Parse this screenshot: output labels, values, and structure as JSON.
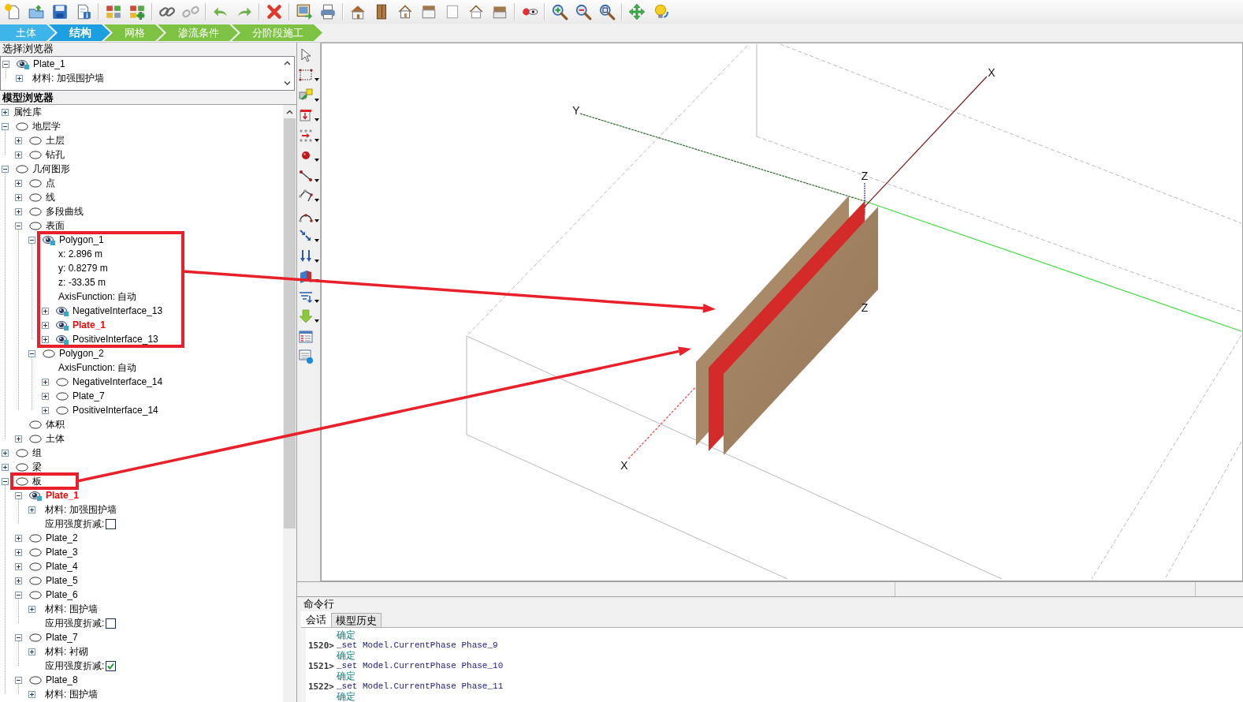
{
  "phases": [
    {
      "label": "土体",
      "color": "#3db5ea",
      "selected": false
    },
    {
      "label": "结构",
      "color": "#1c9fe0",
      "selected": true
    },
    {
      "label": "网格",
      "color": "#7dc242",
      "selected": false
    },
    {
      "label": "渗流条件",
      "color": "#7dc242",
      "selected": false
    },
    {
      "label": "分阶段施工",
      "color": "#7dc242",
      "selected": false
    }
  ],
  "selection_browser": {
    "title": "选择浏览器",
    "items": [
      {
        "kind": "object",
        "label": "Plate_1",
        "expanded": true,
        "visible": true,
        "selected": false,
        "highlighted": false,
        "children": [
          {
            "kind": "property",
            "label": "材料: 加强围护墙",
            "expanded": false,
            "selected": false,
            "highlighted": false
          }
        ]
      }
    ]
  },
  "model_browser": {
    "title": "模型浏览器",
    "tree": [
      {
        "kind": "group",
        "label": "属性库",
        "expanded": false,
        "selected": false,
        "highlighted": false
      },
      {
        "kind": "object",
        "label": "地层学",
        "expanded": true,
        "visible": false,
        "selected": false,
        "highlighted": false,
        "children": [
          {
            "kind": "object",
            "label": "土层",
            "expanded": false,
            "visible": false,
            "selected": false,
            "highlighted": false
          },
          {
            "kind": "object",
            "label": "钻孔",
            "expanded": false,
            "visible": false,
            "selected": false,
            "highlighted": false
          }
        ]
      },
      {
        "kind": "object",
        "label": "几何图形",
        "expanded": true,
        "visible": false,
        "selected": false,
        "highlighted": false,
        "children": [
          {
            "kind": "object",
            "label": "点",
            "expanded": false,
            "visible": false,
            "selected": false,
            "highlighted": false
          },
          {
            "kind": "object",
            "label": "线",
            "expanded": false,
            "visible": false,
            "selected": false,
            "highlighted": false
          },
          {
            "kind": "object",
            "label": "多段曲线",
            "expanded": false,
            "visible": false,
            "selected": false,
            "highlighted": false
          },
          {
            "kind": "object",
            "label": "表面",
            "expanded": true,
            "visible": false,
            "selected": false,
            "highlighted": false,
            "children": [
              {
                "kind": "object",
                "label": "Polygon_1",
                "expanded": true,
                "visible": true,
                "selected": false,
                "highlighted": true,
                "children": [
                  {
                    "kind": "property",
                    "label": "x: 2.896 m",
                    "selected": false,
                    "highlighted": true
                  },
                  {
                    "kind": "property",
                    "label": "y: 0.8279 m",
                    "selected": false,
                    "highlighted": true
                  },
                  {
                    "kind": "property",
                    "label": "z: -33.35 m",
                    "selected": false,
                    "highlighted": true
                  },
                  {
                    "kind": "property",
                    "label": "AxisFunction: 自动",
                    "selected": false,
                    "highlighted": true
                  },
                  {
                    "kind": "object",
                    "label": "NegativeInterface_13",
                    "expanded": false,
                    "visible": true,
                    "selected": false,
                    "highlighted": true
                  },
                  {
                    "kind": "object",
                    "label": "Plate_1",
                    "expanded": false,
                    "visible": true,
                    "selected": true,
                    "highlighted": true
                  },
                  {
                    "kind": "object",
                    "label": "PositiveInterface_13",
                    "expanded": false,
                    "visible": true,
                    "selected": false,
                    "highlighted": true
                  }
                ]
              },
              {
                "kind": "object",
                "label": "Polygon_2",
                "expanded": true,
                "visible": false,
                "selected": false,
                "highlighted": false,
                "children": [
                  {
                    "kind": "property",
                    "label": "AxisFunction: 自动",
                    "selected": false,
                    "highlighted": false
                  },
                  {
                    "kind": "object",
                    "label": "NegativeInterface_14",
                    "expanded": false,
                    "visible": false,
                    "selected": false,
                    "highlighted": false
                  },
                  {
                    "kind": "object",
                    "label": "Plate_7",
                    "expanded": false,
                    "visible": false,
                    "selected": false,
                    "highlighted": false
                  },
                  {
                    "kind": "object",
                    "label": "PositiveInterface_14",
                    "expanded": false,
                    "visible": false,
                    "selected": false,
                    "highlighted": false
                  }
                ]
              }
            ]
          },
          {
            "kind": "object",
            "label": "体积",
            "visible": false,
            "selected": false,
            "highlighted": false
          },
          {
            "kind": "object",
            "label": "土体",
            "expanded": false,
            "visible": false,
            "selected": false,
            "highlighted": false
          }
        ]
      },
      {
        "kind": "object",
        "label": "组",
        "expanded": false,
        "visible": false,
        "selected": false,
        "highlighted": false
      },
      {
        "kind": "object",
        "label": "梁",
        "expanded": false,
        "visible": false,
        "selected": false,
        "highlighted": false
      },
      {
        "kind": "object",
        "label": "板",
        "expanded": true,
        "visible": false,
        "selected": false,
        "highlighted": true,
        "children": [
          {
            "kind": "object",
            "label": "Plate_1",
            "expanded": true,
            "visible": true,
            "selected": true,
            "highlighted": false,
            "children": [
              {
                "kind": "property",
                "label": "材料: 加强围护墙",
                "expanded": false,
                "selected": false,
                "highlighted": false
              },
              {
                "kind": "checkbox",
                "label": "应用强度折减:",
                "checked": false,
                "selected": false,
                "highlighted": false
              }
            ]
          },
          {
            "kind": "object",
            "label": "Plate_2",
            "expanded": false,
            "visible": false,
            "selected": false,
            "highlighted": false
          },
          {
            "kind": "object",
            "label": "Plate_3",
            "expanded": false,
            "visible": false,
            "selected": false,
            "highlighted": false
          },
          {
            "kind": "object",
            "label": "Plate_4",
            "expanded": false,
            "visible": false,
            "selected": false,
            "highlighted": false
          },
          {
            "kind": "object",
            "label": "Plate_5",
            "expanded": false,
            "visible": false,
            "selected": false,
            "highlighted": false
          },
          {
            "kind": "object",
            "label": "Plate_6",
            "expanded": true,
            "visible": false,
            "selected": false,
            "highlighted": false,
            "children": [
              {
                "kind": "property",
                "label": "材料: 围护墙",
                "expanded": false,
                "selected": false,
                "highlighted": false
              },
              {
                "kind": "checkbox",
                "label": "应用强度折减:",
                "checked": false,
                "selected": false,
                "highlighted": false
              }
            ]
          },
          {
            "kind": "object",
            "label": "Plate_7",
            "expanded": true,
            "visible": false,
            "selected": false,
            "highlighted": false,
            "children": [
              {
                "kind": "property",
                "label": "材料: 衬砌",
                "expanded": false,
                "selected": false,
                "highlighted": false
              },
              {
                "kind": "checkbox",
                "label": "应用强度折减:",
                "checked": true,
                "selected": false,
                "highlighted": false
              }
            ]
          },
          {
            "kind": "object",
            "label": "Plate_8",
            "expanded": true,
            "visible": false,
            "selected": false,
            "highlighted": false,
            "children": [
              {
                "kind": "property",
                "label": "材料: 围护墙",
                "expanded": false,
                "selected": false,
                "highlighted": false
              }
            ]
          }
        ]
      }
    ]
  },
  "viewport": {
    "axis_labels": [
      "Y",
      "X",
      "Z",
      "Z",
      "X"
    ]
  },
  "command_line": {
    "title": "命令行",
    "tabs": [
      {
        "label": "会话",
        "selected": true
      },
      {
        "label": "模型历史",
        "selected": false
      }
    ],
    "lines": [
      {
        "kind": "response",
        "text": "确定"
      },
      {
        "kind": "command",
        "number": "1520>",
        "text": "_set Model.CurrentPhase Phase_9"
      },
      {
        "kind": "response",
        "text": "确定"
      },
      {
        "kind": "command",
        "number": "1521>",
        "text": "_set Model.CurrentPhase Phase_10"
      },
      {
        "kind": "response",
        "text": "确定"
      },
      {
        "kind": "command",
        "number": "1522>",
        "text": "_set Model.CurrentPhase Phase_11"
      },
      {
        "kind": "response",
        "text": "确定"
      }
    ]
  }
}
